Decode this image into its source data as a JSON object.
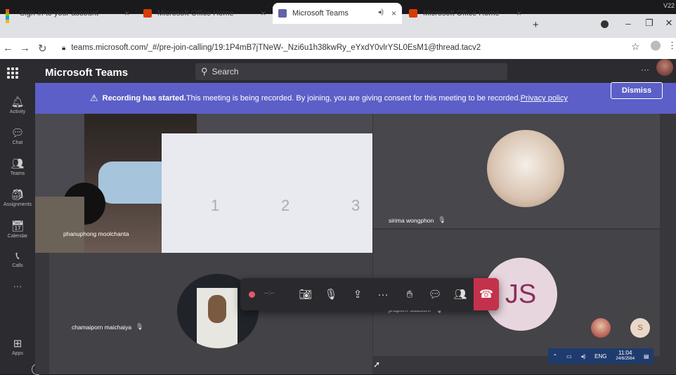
{
  "corner_text": "V22",
  "tabs": [
    {
      "label": "Sign in to your account",
      "icon": "microsoft-logo-icon"
    },
    {
      "label": "Microsoft Office Home",
      "icon": "office-icon"
    },
    {
      "label": "Microsoft Teams",
      "icon": "teams-icon"
    },
    {
      "label": "Microsoft Office Home",
      "icon": "office-icon"
    }
  ],
  "tab_close": "×",
  "new_tab": "+",
  "window": {
    "minimize": "–",
    "restore": "❐",
    "close": "✕"
  },
  "address": {
    "url": "teams.microsoft.com/_#/pre-join-calling/19:1P4mB7jTNeW-_Nzi6u1h38kwRy_eYxdY0vlrYSL0EsM1@thread.tacv2"
  },
  "header": {
    "app_name": "Microsoft Teams",
    "search_placeholder": "Search",
    "more": "···"
  },
  "rail": [
    {
      "label": "Activity",
      "icon": "bell-icon"
    },
    {
      "label": "Chat",
      "icon": "chat-icon"
    },
    {
      "label": "Teams",
      "icon": "teams-icon"
    },
    {
      "label": "Assignments",
      "icon": "assignments-icon"
    },
    {
      "label": "Calendar",
      "icon": "calendar-icon"
    },
    {
      "label": "Calls",
      "icon": "phone-icon"
    },
    {
      "label": "Apps",
      "icon": "apps-icon"
    }
  ],
  "rail_more": "···",
  "banner": {
    "bold": "Recording has started.",
    "text": " This meeting is being recorded. By joining, you are giving consent for this meeting to be recorded. ",
    "link": "Privacy policy",
    "dismiss": "Dismiss"
  },
  "participants": [
    {
      "name": "phanuphong moolchanta"
    },
    {
      "name": "sirima wongphon"
    },
    {
      "name": "chamaiporn maichaiya"
    },
    {
      "name": "jirapom sudsom",
      "initials": "JS"
    }
  ],
  "paper_digits": [
    "1",
    "2",
    "3"
  ],
  "toolbar": {
    "timer": "--:--"
  },
  "avatars": {
    "small_initial": "S"
  },
  "taskbar": {
    "lang": "ENG",
    "time": "11:04",
    "date": "24/6/2564"
  }
}
